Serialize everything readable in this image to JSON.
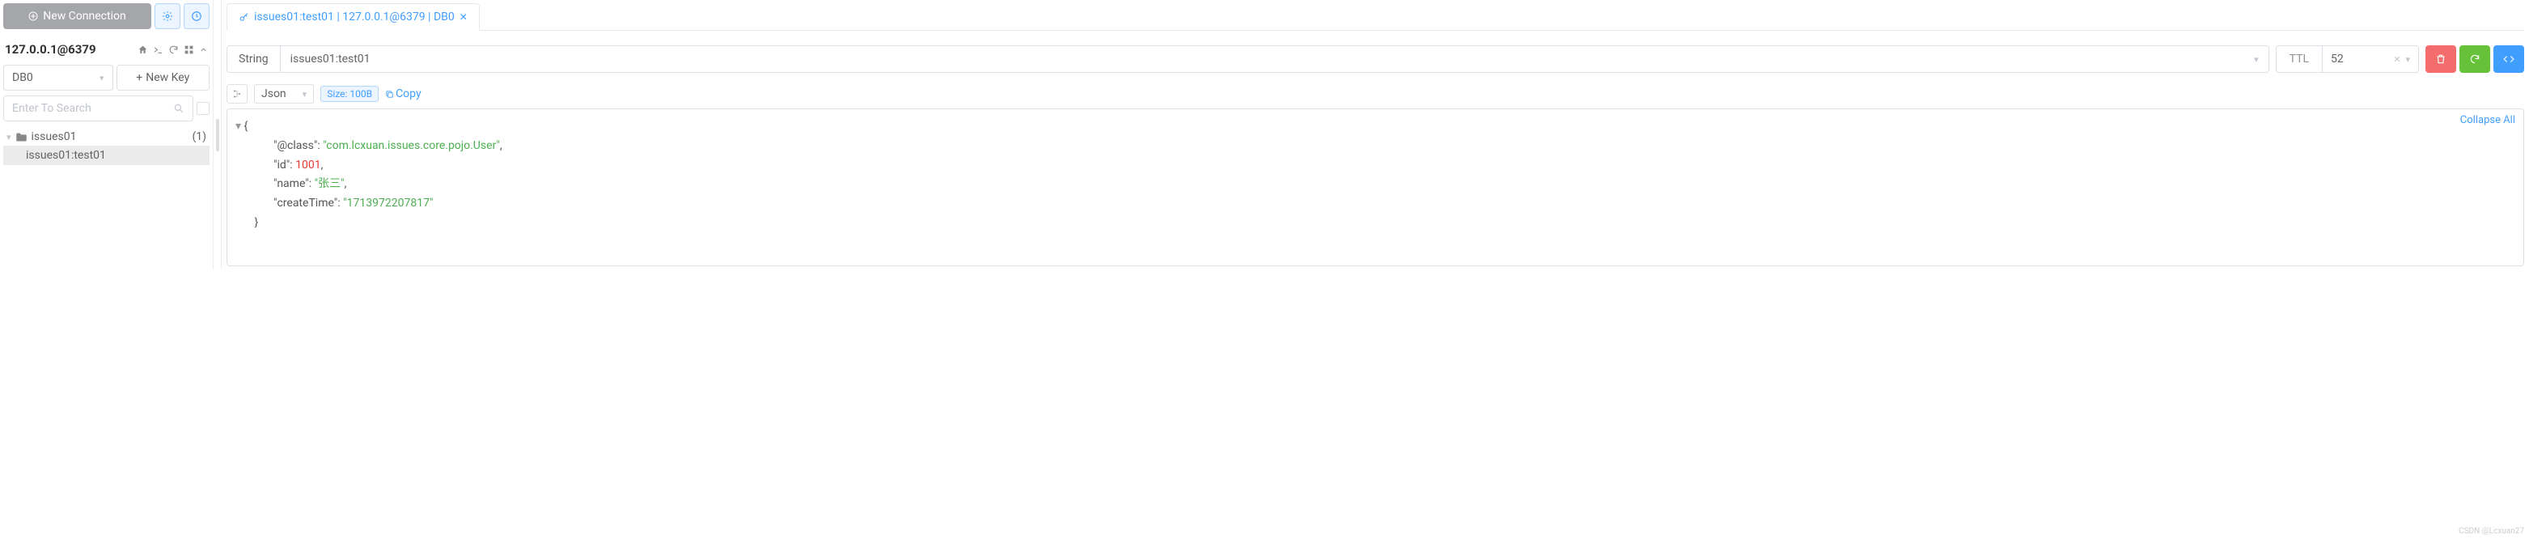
{
  "left": {
    "new_connection": "New Connection",
    "conn_title": "127.0.0.1@6379",
    "db_select": "DB0",
    "new_key": "New Key",
    "search_placeholder": "Enter To Search",
    "folder_name": "issues01",
    "folder_count": "(1)",
    "key_name": "issues01:test01"
  },
  "tab": {
    "label": "issues01:test01 | 127.0.0.1@6379 | DB0"
  },
  "main": {
    "type": "String",
    "key": "issues01:test01",
    "ttl_label": "TTL",
    "ttl_value": "52",
    "format": "Json",
    "size": "Size: 100B",
    "copy": "Copy",
    "collapse": "Collapse All"
  },
  "json_obj": {
    "k1": "\"@class\"",
    "v1": "\"com.lcxuan.issues.core.pojo.User\"",
    "k2": "\"id\"",
    "v2": "1001",
    "k3": "\"name\"",
    "v3": "\"张三\"",
    "k4": "\"createTime\"",
    "v4": "\"1713972207817\""
  },
  "watermark": "CSDN @Lcxuan27"
}
